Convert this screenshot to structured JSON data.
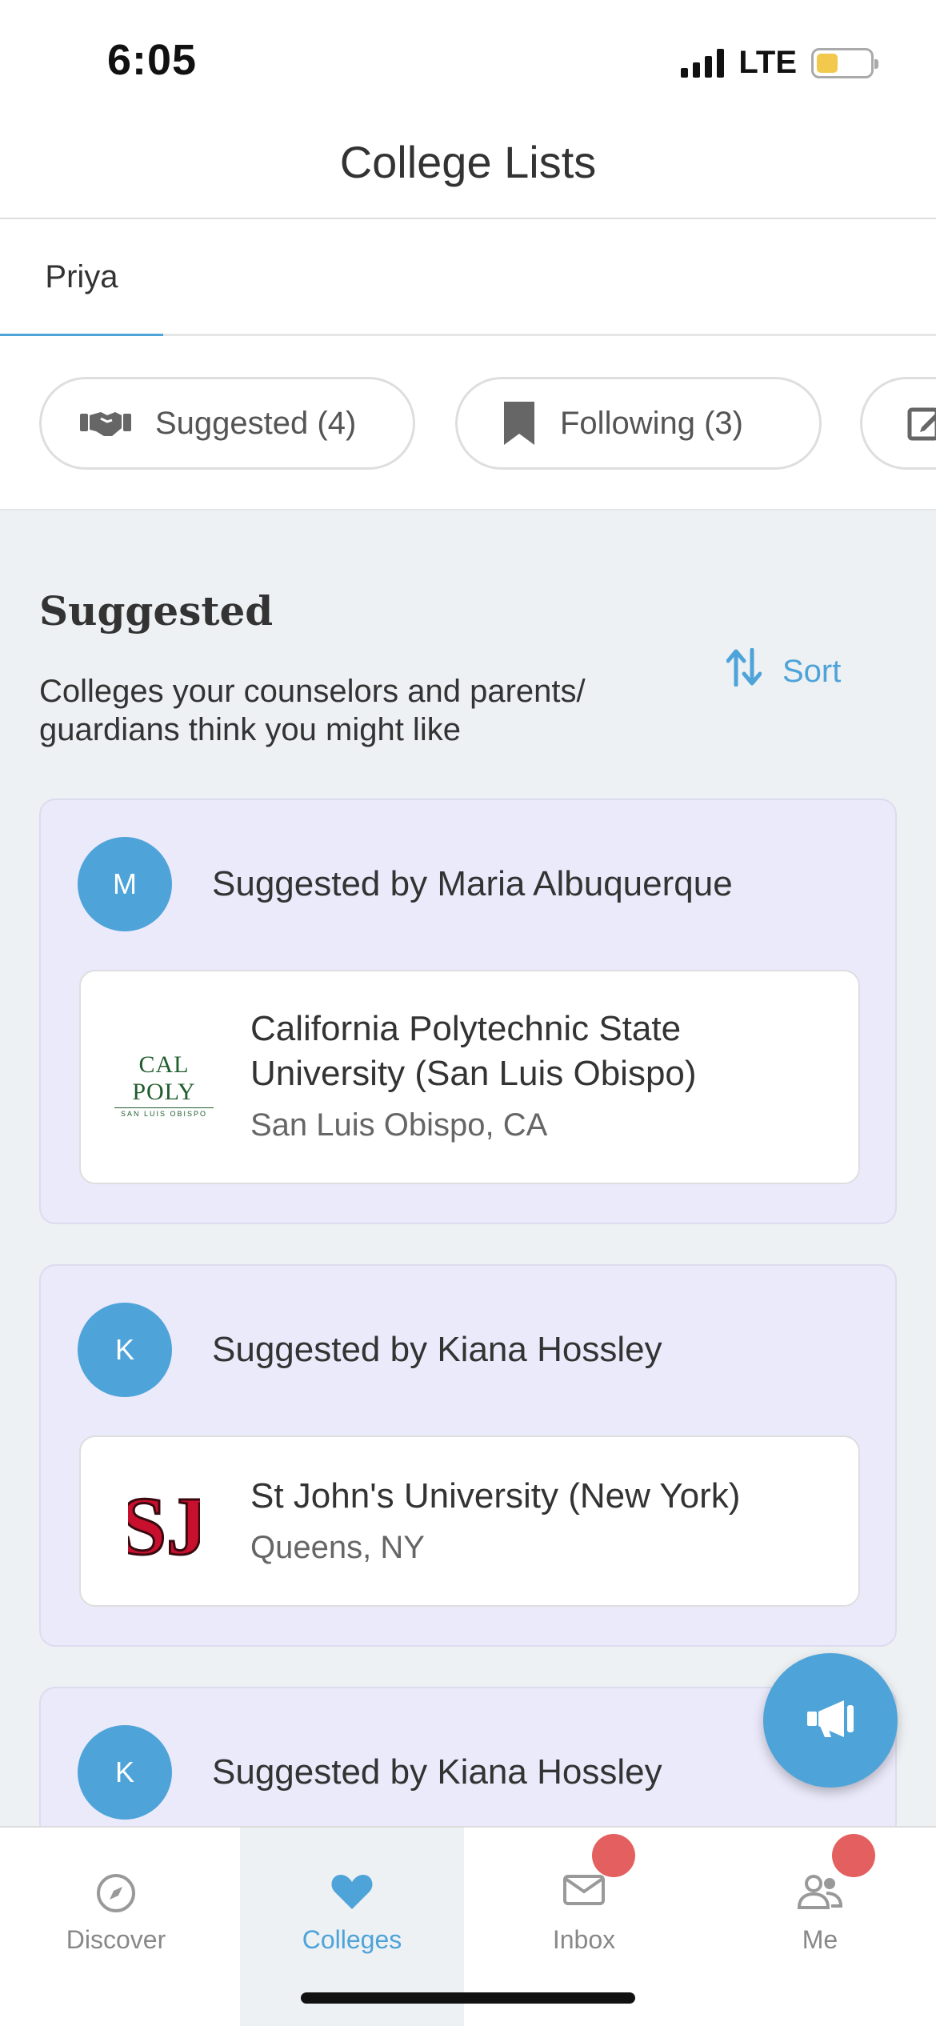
{
  "status_bar": {
    "time": "6:05",
    "network": "LTE"
  },
  "header": {
    "title": "College Lists"
  },
  "student_tabs": [
    {
      "label": "Priya",
      "active": true
    }
  ],
  "filters": [
    {
      "label": "Suggested (4)",
      "icon": "handshake-icon"
    },
    {
      "label": "Following (3)",
      "icon": "bookmark-icon"
    },
    {
      "label": "",
      "icon": "edit-icon"
    }
  ],
  "section": {
    "title": "Suggested",
    "description": "Colleges your counselors and parents/ guardians think you might like",
    "sort_label": "Sort"
  },
  "suggestions": [
    {
      "avatar_initial": "M",
      "suggested_by": "Suggested by Maria Albuquerque",
      "college": {
        "name": "California Polytechnic State University (San Luis Obispo)",
        "location": "San Luis Obispo, CA",
        "logo_text": "CAL POLY",
        "logo_subtext": "SAN LUIS OBISPO"
      }
    },
    {
      "avatar_initial": "K",
      "suggested_by": "Suggested by Kiana Hossley",
      "college": {
        "name": "St John's University (New York)",
        "location": "Queens, NY",
        "logo_text": "SJ"
      }
    },
    {
      "avatar_initial": "K",
      "suggested_by": "Suggested by Kiana Hossley"
    }
  ],
  "bottom_nav": [
    {
      "label": "Discover",
      "icon": "compass-icon",
      "active": false
    },
    {
      "label": "Colleges",
      "icon": "heart-icon",
      "active": true
    },
    {
      "label": "Inbox",
      "icon": "mail-icon",
      "active": false,
      "badge": true
    },
    {
      "label": "Me",
      "icon": "people-icon",
      "active": false,
      "badge": true
    }
  ],
  "colors": {
    "accent": "#4ea3d9",
    "card_bg": "#ebeafb",
    "content_bg": "#edf1f3",
    "badge": "#e45f5f",
    "calpoly_green": "#1f5c2e",
    "stjohns_red": "#c8102e"
  }
}
